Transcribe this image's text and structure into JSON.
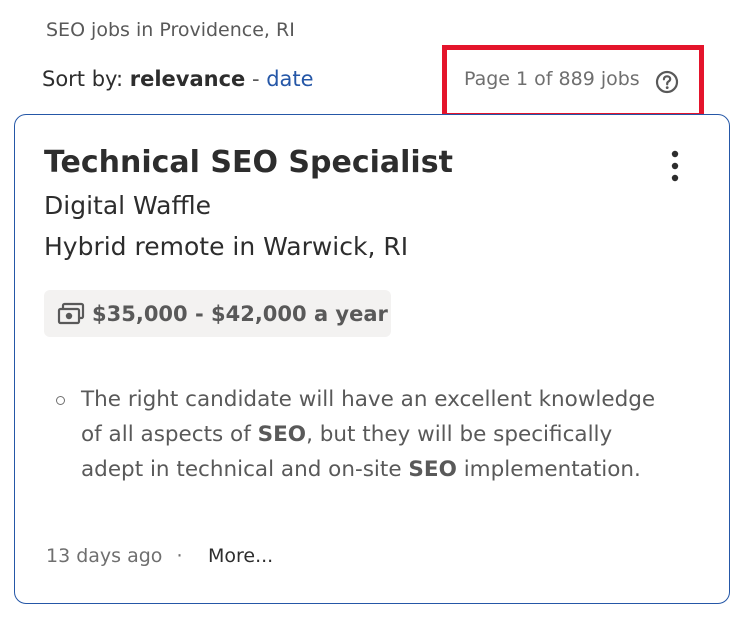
{
  "header": {
    "search_context": "SEO jobs in Providence, RI"
  },
  "sort": {
    "label": "Sort by:",
    "active": "relevance",
    "separator": "-",
    "alternate": "date"
  },
  "pagination": {
    "text": "Page 1 of 889 jobs",
    "help_icon": "question-circle-icon",
    "highlight_color": "#e4142b"
  },
  "job": {
    "title": "Technical SEO Specialist",
    "company": "Digital Waffle",
    "location": "Hybrid remote in Warwick, RI",
    "salary": "$35,000 - $42,000 a year",
    "salary_icon": "money-bills-icon",
    "menu_icon": "more-vertical-icon",
    "snippet": {
      "part1": "The right candidate will have an excellent knowledge of all aspects of ",
      "bold1": "SEO",
      "part2": ", but they will be specifically adept in technical and on-site ",
      "bold2": "SEO",
      "part3": " implementation."
    },
    "posted": "13 days ago",
    "dot": "·",
    "more_label": "More..."
  },
  "colors": {
    "accent": "#2557a7",
    "text": "#2d2d2d",
    "muted": "#595959",
    "badge_bg": "#f3f2f1"
  }
}
